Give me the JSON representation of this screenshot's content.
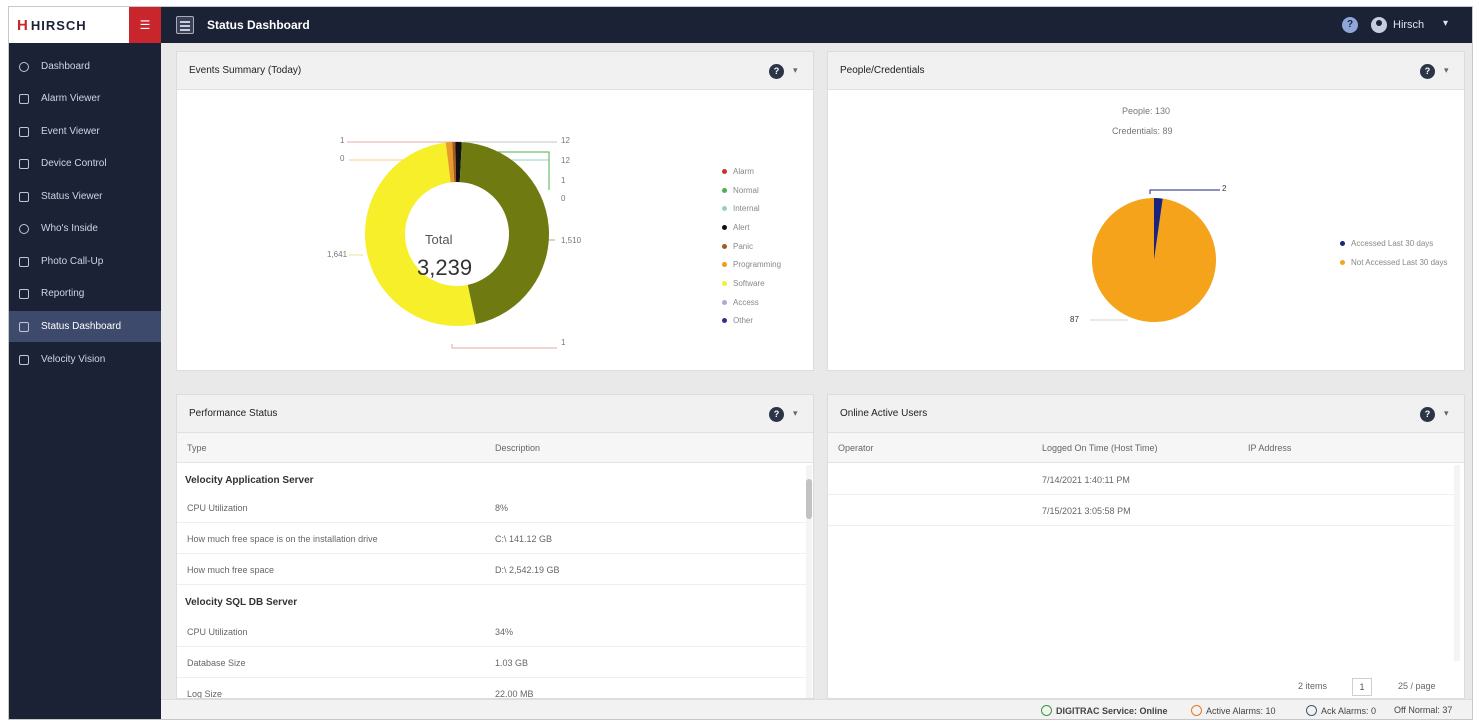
{
  "app": {
    "logo_mark": "H",
    "logo_text": "HIRSCH",
    "menu_toggle": "☰",
    "page_title": "Status Dashboard",
    "user_name": "Hirsch",
    "help_glyph": "?",
    "caret": "▾"
  },
  "sidebar": {
    "items": [
      {
        "label": "Dashboard",
        "icon": "dashboard-icon"
      },
      {
        "label": "Alarm Viewer",
        "icon": "alarm-icon"
      },
      {
        "label": "Event Viewer",
        "icon": "event-icon"
      },
      {
        "label": "Device Control",
        "icon": "device-icon"
      },
      {
        "label": "Status Viewer",
        "icon": "status-icon"
      },
      {
        "label": "Who's Inside",
        "icon": "people-icon"
      },
      {
        "label": "Photo Call-Up",
        "icon": "photo-icon"
      },
      {
        "label": "Reporting",
        "icon": "report-icon"
      },
      {
        "label": "Status Dashboard",
        "icon": "dashboard-grid-icon",
        "active": true
      },
      {
        "label": "Velocity Vision",
        "icon": "vision-icon"
      }
    ]
  },
  "events_panel": {
    "title": "Events Summary (Today)",
    "center_label": "Total",
    "center_value": "3,239",
    "slice_labels": {
      "top_left_a": "1",
      "top_left_b": "0",
      "top_right_a": "12",
      "top_right_b": "12",
      "top_right_c": "1",
      "top_right_d": "0",
      "right": "1,510",
      "left": "1,641",
      "bottom": "1"
    }
  },
  "events_chart": {
    "type": "pie",
    "categories": [
      "Alarm",
      "Normal",
      "Internal",
      "Alert",
      "Panic",
      "Programming",
      "Software",
      "Access",
      "Other"
    ],
    "colors": [
      "#c0392b",
      "#4caf50",
      "#8fd6c2",
      "#111111",
      "#a35a1f",
      "#f39c12",
      "#f7ef2a",
      "#b7a3d6",
      "#3b2d8f"
    ]
  },
  "people_panel": {
    "title": "People/Credentials",
    "people_line": "People: 130",
    "credentials_line": "Credentials: 89",
    "label_small": "2",
    "label_large": "87"
  },
  "people_chart": {
    "type": "pie",
    "categories": [
      "Accessed Last 30 days",
      "Not Accessed Last 30 days"
    ],
    "values": [
      2,
      87
    ],
    "colors": [
      "#1a237e",
      "#f5a31a"
    ]
  },
  "performance_panel": {
    "title": "Performance Status",
    "columns": [
      "Type",
      "Description"
    ],
    "groups": [
      {
        "name": "Velocity Application Server",
        "rows": [
          {
            "type": "CPU Utilization",
            "description": "8%"
          },
          {
            "type": "How much free space is on the installation drive",
            "description": "C:\\ 141.12 GB"
          },
          {
            "type": "How much free space",
            "description": "D:\\ 2,542.19 GB"
          }
        ]
      },
      {
        "name": "Velocity SQL DB Server",
        "rows": [
          {
            "type": "CPU Utilization",
            "description": "34%"
          },
          {
            "type": "Database Size",
            "description": "1.03 GB"
          },
          {
            "type": "Log Size",
            "description": "22.00 MB"
          }
        ]
      }
    ]
  },
  "online_users_panel": {
    "title": "Online Active Users",
    "columns": [
      "Operator",
      "Logged On Time (Host Time)",
      "IP Address"
    ],
    "rows": [
      {
        "operator": "",
        "logged_on": "7/14/2021 1:40:11 PM",
        "ip": ""
      },
      {
        "operator": "",
        "logged_on": "7/15/2021 3:05:58 PM",
        "ip": ""
      }
    ],
    "pager": {
      "total": "2 items",
      "page": "1",
      "page_size": "25 / page"
    }
  },
  "statusbar": {
    "service": "DIGITRAC Service: Online",
    "active_alarms": "Active Alarms: 10",
    "ack_alarms": "Ack Alarms: 0",
    "off_normal": "Off Normal: 37",
    "colors": {
      "online": "#3a9a3a",
      "alarm": "#e07b2a",
      "ack": "#4a5670"
    }
  }
}
